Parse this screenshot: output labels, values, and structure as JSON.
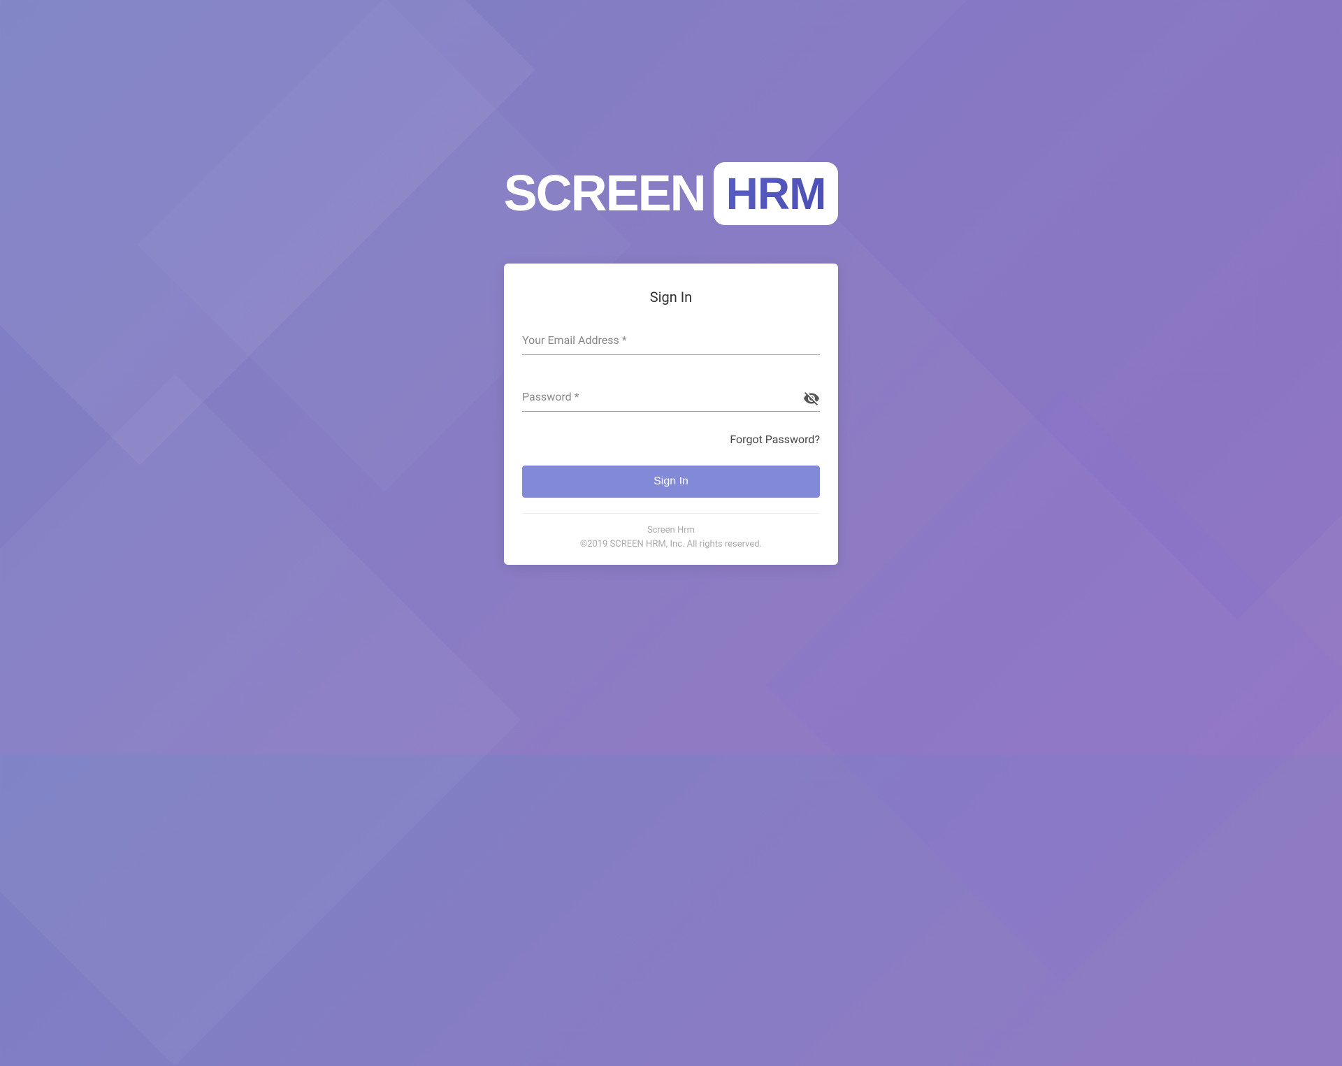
{
  "logo": {
    "text1": "SCREEN",
    "text2": "HRM"
  },
  "card": {
    "title": "Sign In",
    "email_label": "Your Email Address *",
    "email_value": "",
    "password_label": "Password *",
    "password_value": "",
    "forgot_password": "Forgot Password?",
    "signin_button": "Sign In"
  },
  "footer": {
    "line1": "Screen Hrm",
    "line2": "©2019 SCREEN HRM, Inc. All rights reserved."
  }
}
